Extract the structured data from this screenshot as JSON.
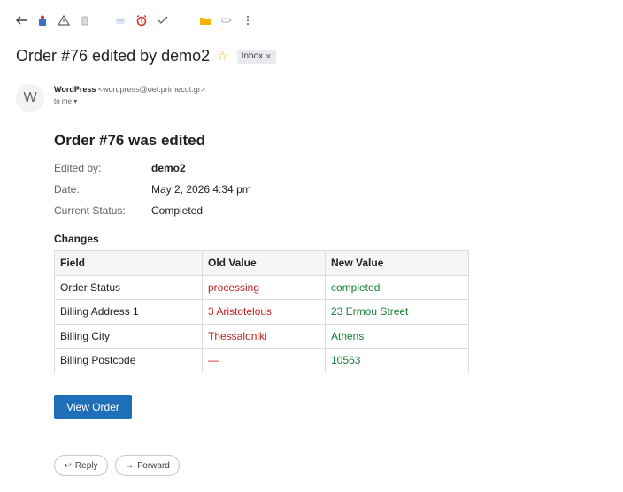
{
  "toolbar": {
    "icons": [
      "back-icon",
      "archive-icon",
      "report-spam-icon",
      "delete-icon",
      "mark-unread-icon",
      "snooze-icon",
      "add-task-icon",
      "move-to-icon",
      "labels-icon",
      "more-icon"
    ]
  },
  "email": {
    "subject": "Order #76 edited by demo2",
    "label": "Inbox",
    "label_close": "×",
    "sender_initial": "W",
    "sender_name": "WordPress",
    "sender_email": "<wordpress@oet.primecut.gr>",
    "to": "to me",
    "heading": "Order #76 was edited",
    "details": [
      {
        "key": "Edited by:",
        "value": "demo2"
      },
      {
        "key": "Date:",
        "value": "May 2, 2026 4:34 pm"
      },
      {
        "key": "Current Status:",
        "value": "Completed"
      }
    ],
    "changes_heading": "Changes",
    "table": {
      "headers": [
        "Field",
        "Old Value",
        "New Value"
      ],
      "rows": [
        [
          "Order Status",
          "processing",
          "completed"
        ],
        [
          "Billing Address 1",
          "3 Aristotelous",
          "23 Ermou Street"
        ],
        [
          "Billing City",
          "Thessaloniki",
          "Athens"
        ],
        [
          "Billing Postcode",
          "—",
          "10563"
        ]
      ]
    },
    "view_order_label": "View Order",
    "reply_label": "Reply",
    "forward_label": "Forward",
    "reply_glyph": "↩",
    "forward_glyph": "→"
  },
  "colors": {
    "old_value": "#c5221f",
    "new_value": "#188038",
    "button": "#1f6fb8",
    "star": "#f4b400"
  }
}
